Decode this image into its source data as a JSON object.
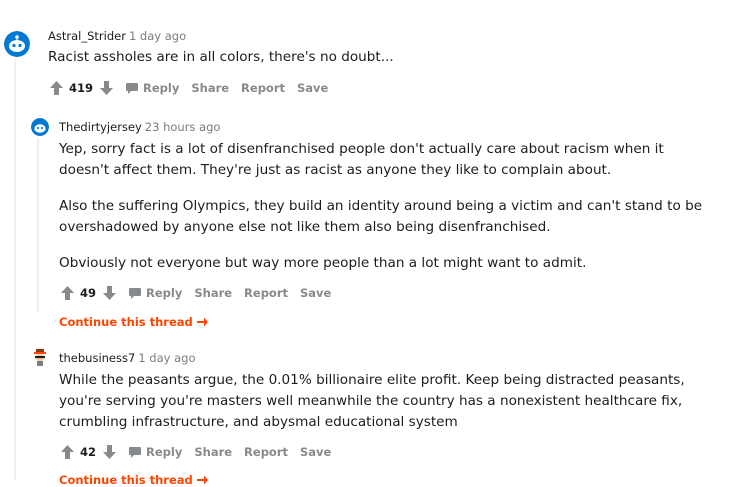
{
  "comments": [
    {
      "username": "Astral_Strider",
      "time": "1 day ago",
      "paragraphs": [
        "Racist assholes are in all colors, there's no doubt..."
      ],
      "score": "419",
      "actions": {
        "reply": "Reply",
        "share": "Share",
        "report": "Report",
        "save": "Save"
      }
    },
    {
      "username": "Thedirtyjersey",
      "time": "23 hours ago",
      "paragraphs": [
        "Yep, sorry fact is a lot of disenfranchised people don't actually care about racism when it doesn't affect them. They're just as racist as anyone they like to complain about.",
        "Also the suffering Olympics, they build an identity around being a victim and can't stand to be overshadowed by anyone else not like them also being disenfranchised.",
        "Obviously not everyone but way more people than a lot might want to admit."
      ],
      "score": "49",
      "actions": {
        "reply": "Reply",
        "share": "Share",
        "report": "Report",
        "save": "Save"
      },
      "continue_label": "Continue this thread"
    },
    {
      "username": "thebusiness7",
      "time": "1 day ago",
      "paragraphs": [
        "While the peasants argue, the 0.01% billionaire elite profit. Keep being distracted peasants, you're serving you're masters well meanwhile the country has a nonexistent healthcare fix, crumbling infrastructure, and abysmal educational system"
      ],
      "score": "42",
      "actions": {
        "reply": "Reply",
        "share": "Share",
        "report": "Report",
        "save": "Save"
      },
      "continue_label": "Continue this thread"
    }
  ],
  "icons": {
    "upvote": "upvote-arrow-icon",
    "downvote": "downvote-arrow-icon",
    "reply": "speech-bubble-icon",
    "continue": "arrow-right-icon",
    "avatar_robot": "snoo-robot-avatar",
    "avatar_character": "snoo-character-avatar"
  },
  "colors": {
    "accent": "#ff4500",
    "muted": "#878a8c",
    "text": "#1c1c1c",
    "thread_line": "#edeff1",
    "avatar_blue": "#0079d3"
  }
}
